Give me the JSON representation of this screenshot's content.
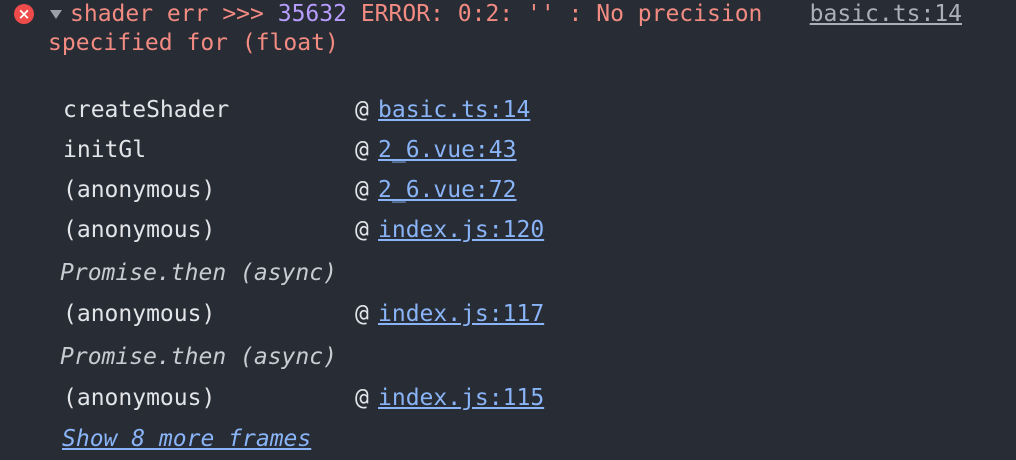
{
  "error": {
    "icon": "×",
    "message_prefix": "shader err >>> ",
    "message_number": "35632",
    "message_rest": " ERROR: 0:2: '' : No precision specified for (float)",
    "source_link": "basic.ts:14",
    "status_color": "#f28b82"
  },
  "stack": {
    "at_symbol": "@",
    "frames": [
      {
        "fn": "createShader",
        "link": "basic.ts:14"
      },
      {
        "fn": "initGl",
        "link": "2_6.vue:43"
      },
      {
        "fn": "(anonymous)",
        "link": "2_6.vue:72"
      },
      {
        "fn": "(anonymous)",
        "link": "index.js:120"
      },
      {
        "fn": "(anonymous)",
        "link": "index.js:117"
      },
      {
        "fn": "(anonymous)",
        "link": "index.js:115"
      }
    ],
    "async_labels": [
      "Promise.then (async)",
      "Promise.then (async)"
    ],
    "show_more": "Show 8 more frames"
  }
}
